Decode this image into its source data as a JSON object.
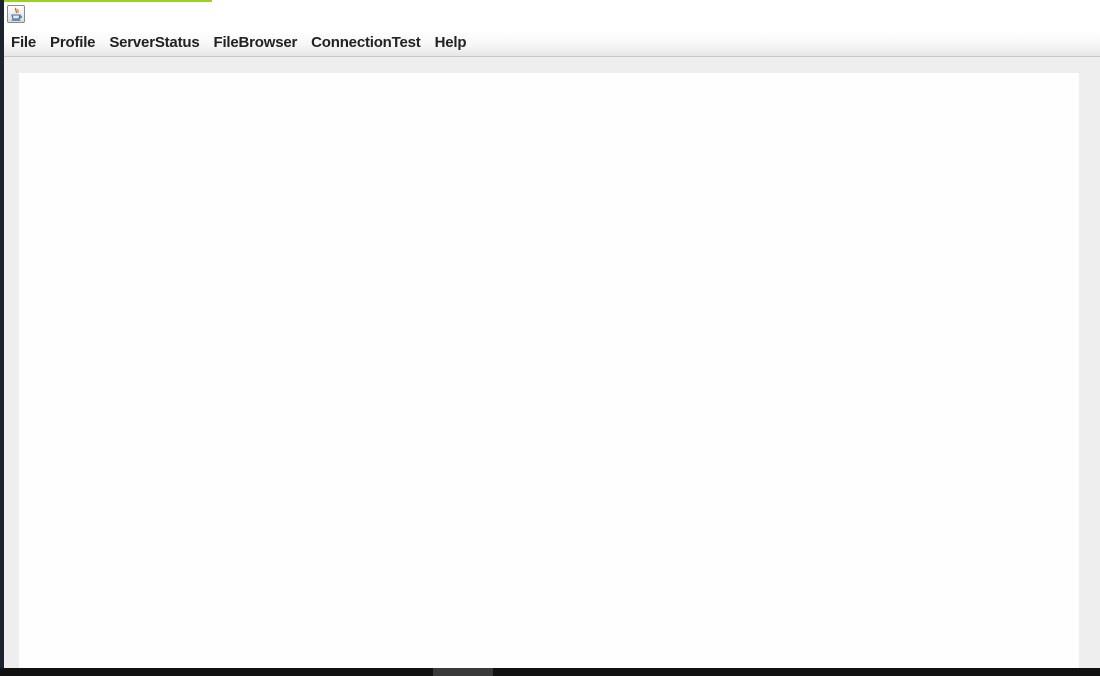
{
  "window": {
    "accent_color": "#9bd21e",
    "icon": "java-cup-icon"
  },
  "menubar": {
    "items": [
      {
        "label": "File"
      },
      {
        "label": "Profile"
      },
      {
        "label": "ServerStatus"
      },
      {
        "label": "FileBrowser"
      },
      {
        "label": "ConnectionTest"
      },
      {
        "label": "Help"
      }
    ]
  },
  "colors": {
    "menubar_text": "#222222",
    "window_background": "#eeeeee",
    "content_background": "#fefefe",
    "desktop_background": "#1b2230"
  }
}
